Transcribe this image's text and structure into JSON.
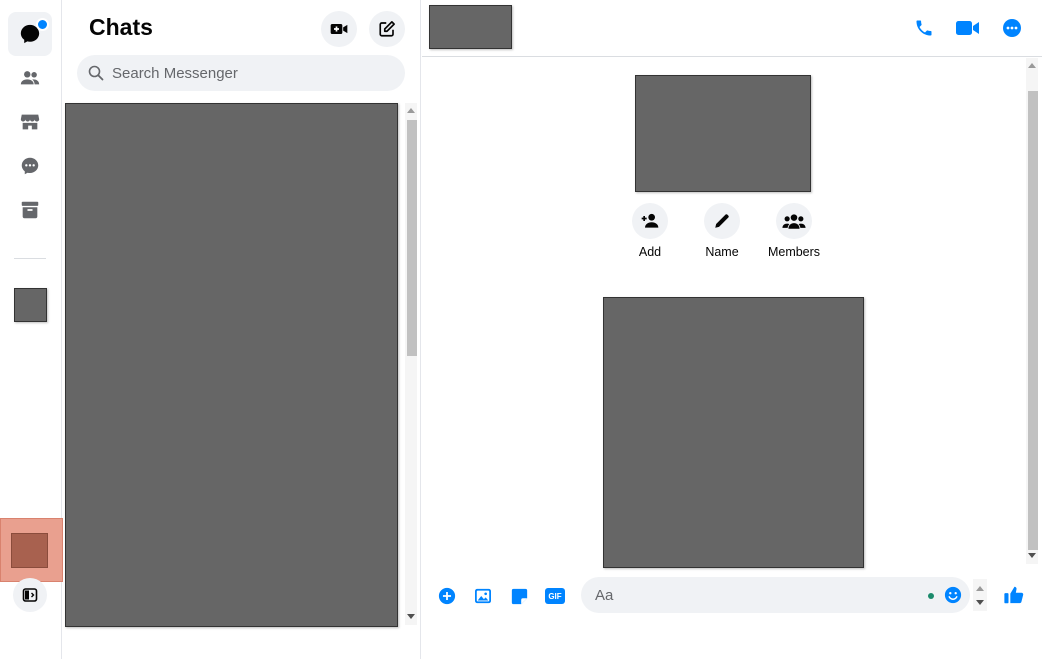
{
  "rail": {
    "items": [
      {
        "name": "chats",
        "icon": "chat-bubble-icon",
        "active": true
      },
      {
        "name": "people",
        "icon": "people-icon"
      },
      {
        "name": "marketplace",
        "icon": "store-icon"
      },
      {
        "name": "requests",
        "icon": "message-requests-icon"
      },
      {
        "name": "archive",
        "icon": "archive-icon"
      }
    ]
  },
  "chats": {
    "title": "Chats",
    "search_placeholder": "Search Messenger"
  },
  "conversation": {
    "actions": [
      {
        "label": "Add",
        "icon": "add-person-icon"
      },
      {
        "label": "Name",
        "icon": "pencil-icon"
      },
      {
        "label": "Members",
        "icon": "members-icon"
      }
    ],
    "composer_placeholder": "Aa",
    "gif_label": "GIF"
  },
  "colors": {
    "accent": "#0084ff",
    "redacted": "#666666",
    "highlight": "#e9a08f",
    "online": "#31a24c"
  }
}
